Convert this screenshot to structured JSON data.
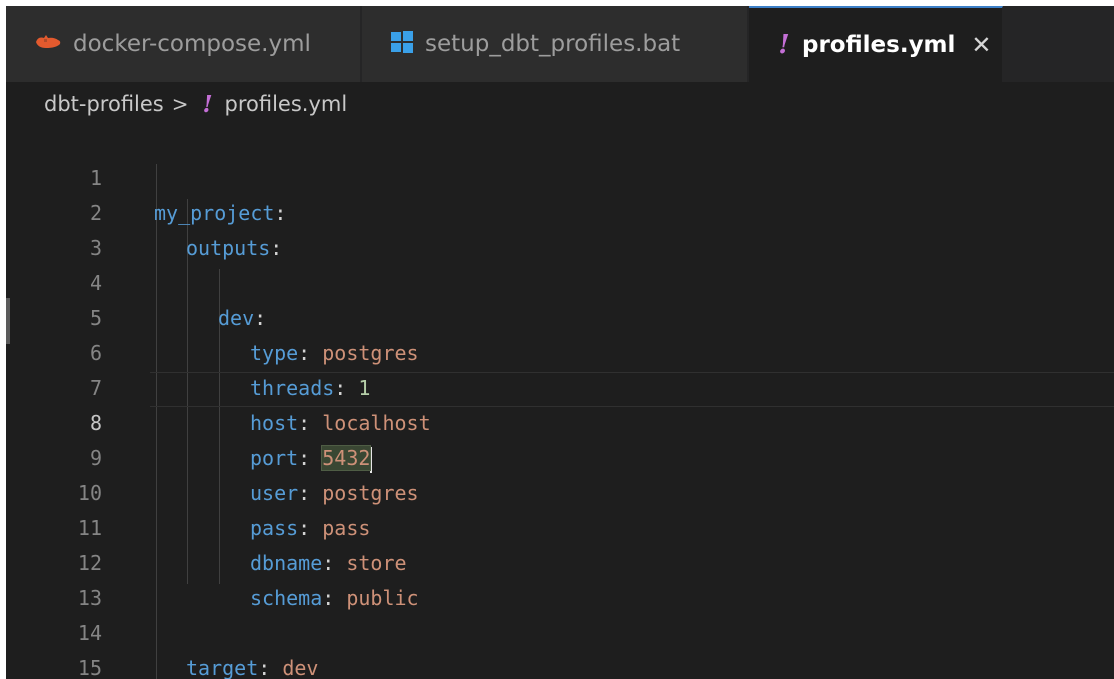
{
  "tabs": [
    {
      "label": "docker-compose.yml",
      "icon": "docker-icon",
      "active": false
    },
    {
      "label": "setup_dbt_profiles.bat",
      "icon": "windows-icon",
      "active": false
    },
    {
      "label": "profiles.yml",
      "icon": "yaml-bang-icon",
      "active": true
    }
  ],
  "breadcrumb": {
    "folder": "dbt-profiles",
    "separator": ">",
    "file": "profiles.yml",
    "file_icon_glyph": "!"
  },
  "tab_icon_glyph": "!",
  "close_glyph": "✕",
  "editor": {
    "current_line": 8,
    "lines": [
      {
        "num": "1",
        "key": "my_project",
        "colon": ":",
        "value": ""
      },
      {
        "num": "2",
        "key": "outputs",
        "colon": ":",
        "value": ""
      },
      {
        "num": "3",
        "key": "",
        "colon": "",
        "value": ""
      },
      {
        "num": "4",
        "key": "dev",
        "colon": ":",
        "value": ""
      },
      {
        "num": "5",
        "key": "type",
        "colon": ": ",
        "value": "postgres"
      },
      {
        "num": "6",
        "key": "threads",
        "colon": ": ",
        "value": "1"
      },
      {
        "num": "7",
        "key": "host",
        "colon": ": ",
        "value": "localhost"
      },
      {
        "num": "8",
        "key": "port",
        "colon": ": ",
        "value": "5432"
      },
      {
        "num": "9",
        "key": "user",
        "colon": ": ",
        "value": "postgres"
      },
      {
        "num": "10",
        "key": "pass",
        "colon": ": ",
        "value": "pass"
      },
      {
        "num": "11",
        "key": "dbname",
        "colon": ": ",
        "value": "store"
      },
      {
        "num": "12",
        "key": "schema",
        "colon": ": ",
        "value": "public"
      },
      {
        "num": "13",
        "key": "",
        "colon": "",
        "value": ""
      },
      {
        "num": "14",
        "key": "target",
        "colon": ": ",
        "value": "dev"
      },
      {
        "num": "15",
        "key": "",
        "colon": "",
        "value": ""
      }
    ]
  },
  "colors": {
    "key": "#569cd6",
    "string": "#ce9178",
    "number": "#b5cea8",
    "yaml_icon": "#c46fd6",
    "docker_icon": "#e35a2e",
    "windows_icon": "#3aa0e8",
    "active_tab_border": "#3c7fc7"
  }
}
